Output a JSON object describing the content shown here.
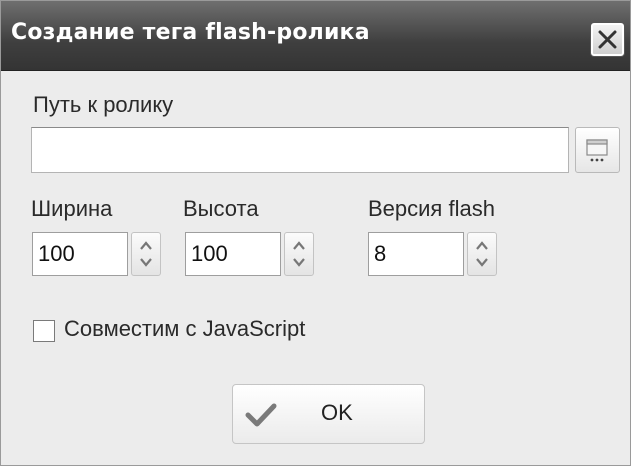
{
  "window": {
    "title": "Создание тега flash-ролика",
    "close_icon": "close-icon"
  },
  "path": {
    "label": "Путь к ролику",
    "value": "",
    "browse_icon": "folder-browse-icon"
  },
  "width": {
    "label": "Ширина",
    "value": "100"
  },
  "height": {
    "label": "Высота",
    "value": "100"
  },
  "flash_version": {
    "label": "Версия flash",
    "value": "8"
  },
  "javascript_compat": {
    "label": "Совместим с JavaScript",
    "checked": false
  },
  "ok_button": {
    "label": "OK",
    "icon": "checkmark-icon"
  }
}
